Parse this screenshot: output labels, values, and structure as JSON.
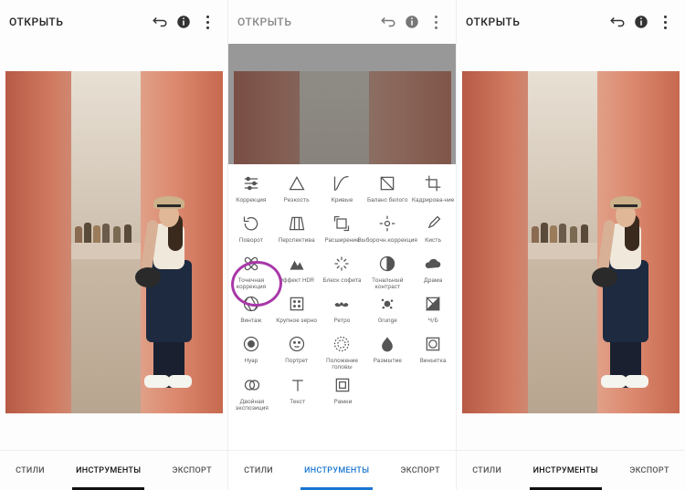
{
  "header": {
    "open_label": "ОТКРЫТЬ"
  },
  "tabs": {
    "styles": "СТИЛИ",
    "tools": "ИНСТРУМЕНТЫ",
    "export": "ЭКСПОРТ"
  },
  "tools": {
    "r1": [
      "Коррекция",
      "Резкость",
      "Кривые",
      "Баланс белого",
      "Кадрирова-ние"
    ],
    "r2": [
      "Поворот",
      "Перспектива",
      "Расширение",
      "Выборочн.коррекция",
      "Кисть"
    ],
    "r3": [
      "Точечная коррекция",
      "Эффект HDR",
      "Блеск софита",
      "Тональный контраст",
      "Драма"
    ],
    "r4": [
      "Винтаж",
      "Крупное зерно",
      "Ретро",
      "Grunge",
      "Ч/Б"
    ],
    "r5": [
      "Нуар",
      "Портрет",
      "Положение головы",
      "Размытие",
      "Виньетка"
    ],
    "r6": [
      "Двойная экспозиция",
      "Текст",
      "Рамки"
    ]
  }
}
